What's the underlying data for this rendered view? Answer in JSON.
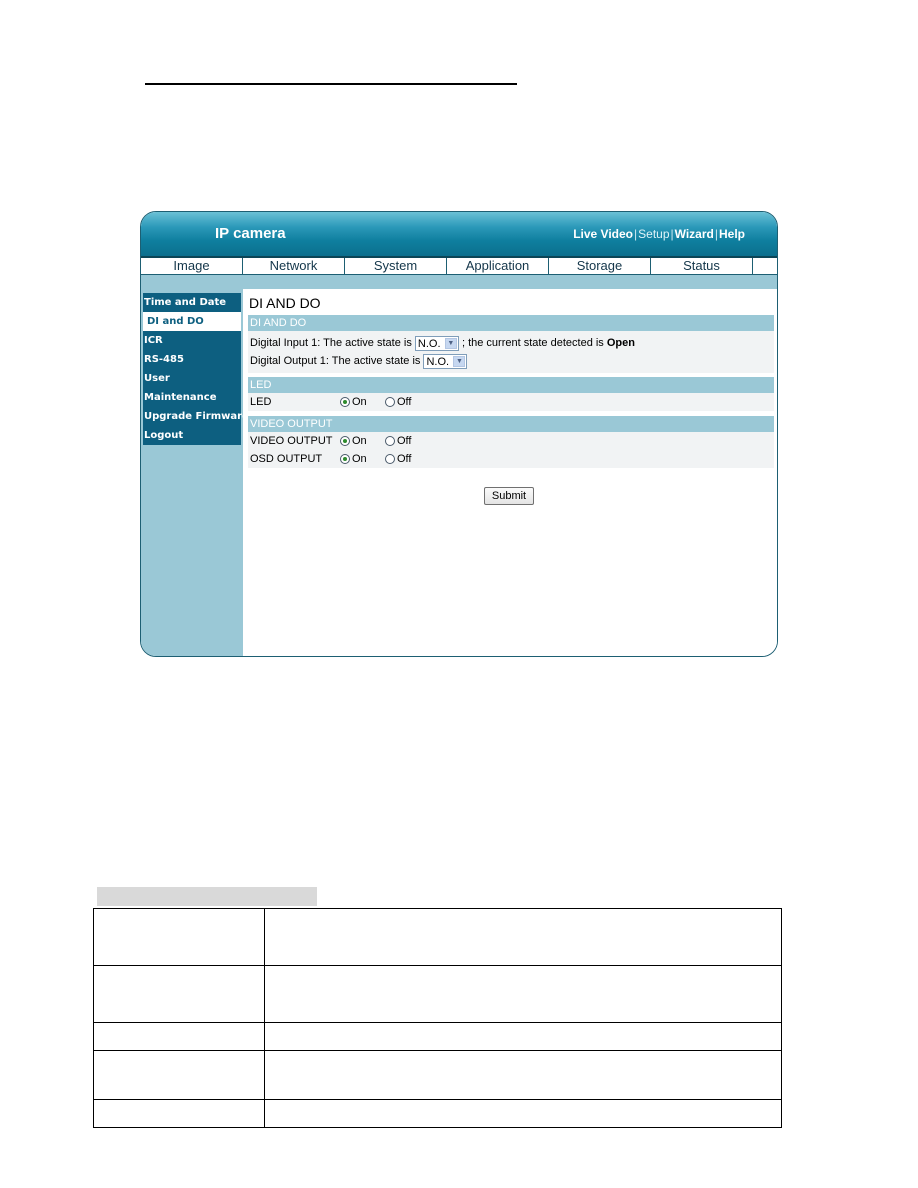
{
  "document": {
    "table_label": "",
    "table_rows": [
      {
        "name": "",
        "description": ""
      },
      {
        "name": "",
        "description": ""
      },
      {
        "name": "",
        "description": ""
      },
      {
        "name": "",
        "description": ""
      },
      {
        "name": "",
        "description": ""
      }
    ]
  },
  "camera_ui": {
    "title": "IP camera",
    "header_links": [
      {
        "label": "Live Video",
        "style": "bold"
      },
      {
        "label": "Setup",
        "style": "thin"
      },
      {
        "label": "Wizard",
        "style": "bold"
      },
      {
        "label": "Help",
        "style": "bold"
      }
    ],
    "tabs": [
      "Image",
      "Network",
      "System",
      "Application",
      "Storage",
      "Status"
    ],
    "sidebar": {
      "items": [
        {
          "label": "Time and Date",
          "active": false
        },
        {
          "label": "DI and DO",
          "active": true
        },
        {
          "label": "ICR",
          "active": false
        },
        {
          "label": "RS-485",
          "active": false
        },
        {
          "label": "User",
          "active": false
        },
        {
          "label": "Maintenance",
          "active": false
        },
        {
          "label": "Upgrade Firmware",
          "active": false
        },
        {
          "label": "Logout",
          "active": false
        }
      ]
    },
    "page_title": "DI AND DO",
    "sections": {
      "di_do": {
        "header": "DI AND DO",
        "di_label": "Digital Input  1: The active state is",
        "di_value": "N.O.",
        "di_state_text": "; the current state detected is",
        "di_state_value": "Open",
        "do_label": "Digital Output 1: The active state is",
        "do_value": "N.O."
      },
      "led": {
        "header": "LED",
        "rows": [
          {
            "label": "LED",
            "on_label": "On",
            "off_label": "Off",
            "selected": "On"
          }
        ]
      },
      "video_output": {
        "header": "VIDEO OUTPUT",
        "rows": [
          {
            "label": "VIDEO OUTPUT",
            "on_label": "On",
            "off_label": "Off",
            "selected": "On"
          },
          {
            "label": "OSD OUTPUT",
            "on_label": "On",
            "off_label": "Off",
            "selected": "On"
          }
        ]
      }
    },
    "submit_label": "Submit",
    "colors": {
      "header_blue": "#0f7f9f",
      "menu_blue": "#0d5f80",
      "section_bar": "#9ac8d6",
      "panel_bg": "#f1f3f4"
    }
  }
}
